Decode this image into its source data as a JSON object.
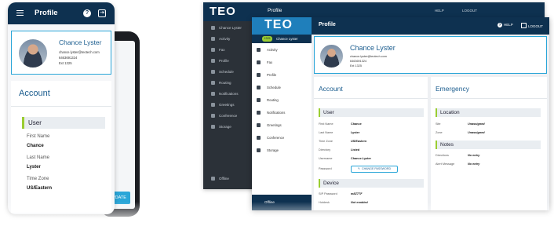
{
  "phone": {
    "title": "Profile",
    "help_glyph": "?",
    "logout_glyph": "⇥",
    "profile": {
      "name": "Chance Lyster",
      "email": "chance.lyster@teotech.com",
      "phone": "6463691324",
      "ext": "Ext 1325"
    },
    "account_heading": "Account",
    "user_section": "User",
    "fields": [
      {
        "label": "First Name",
        "value": "Chance"
      },
      {
        "label": "Last Name",
        "value": "Lyster"
      },
      {
        "label": "Time Zone",
        "value": "US/Eastern"
      }
    ],
    "back_update_button": "UPDATE"
  },
  "desktop_back": {
    "logo": "TEO",
    "title": "Profile",
    "user": "Chance Lyster",
    "help": "HELP",
    "logout": "LOGOUT",
    "sidebar": [
      "Activity",
      "Fax",
      "Profile",
      "Schedule",
      "Routing",
      "Notifications",
      "Greetings",
      "Conference",
      "Storage"
    ],
    "offline": "Offline"
  },
  "desktop": {
    "logo": "TEO",
    "title": "Profile",
    "help": "HELP",
    "logout": "LOGOUT",
    "user_badge": "1325",
    "user_name": "Chance Lyster",
    "sidebar": [
      {
        "label": "Activity",
        "icon": "activity-icon"
      },
      {
        "label": "Fax",
        "icon": "fax-icon"
      },
      {
        "label": "Profile",
        "icon": "profile-icon"
      },
      {
        "label": "Schedule",
        "icon": "schedule-icon"
      },
      {
        "label": "Routing",
        "icon": "routing-icon"
      },
      {
        "label": "Notifications",
        "icon": "bell-icon"
      },
      {
        "label": "Greetings",
        "icon": "greetings-icon"
      },
      {
        "label": "Conference",
        "icon": "conference-icon"
      },
      {
        "label": "Storage",
        "icon": "storage-icon"
      }
    ],
    "offline": "Offline",
    "profile": {
      "name": "Chance Lyster",
      "email": "chance.lyster@teotech.com",
      "phone": "6463691324",
      "ext": "Ext 1325"
    },
    "account": {
      "heading": "Account",
      "user_section": "User",
      "rows": [
        {
          "label": "First Name",
          "value": "Chance"
        },
        {
          "label": "Last Name",
          "value": "Lyster"
        },
        {
          "label": "Time Zone",
          "value": "US/Eastern"
        },
        {
          "label": "Directory",
          "value": "Listed"
        },
        {
          "label": "Username",
          "value": "Chance.Lyster"
        }
      ],
      "password_label": "Password",
      "change_password": "CHANGE PASSWORD",
      "device_section": "Device",
      "device_rows": [
        {
          "label": "SIP Password",
          "value": "m8Z7TF"
        },
        {
          "label": "Hotdesk",
          "value": "Not enabled"
        }
      ]
    },
    "emergency": {
      "heading": "Emergency",
      "location_section": "Location",
      "location_rows": [
        {
          "label": "Site",
          "value": "Unassigned"
        },
        {
          "label": "Zone",
          "value": "Unassigned"
        }
      ],
      "notes_section": "Notes",
      "notes_rows": [
        {
          "label": "Directions",
          "value": "No entry"
        },
        {
          "label": "Alert Message",
          "value": "No entry"
        }
      ]
    }
  },
  "colors": {
    "header_navy": "#0e3150",
    "accent_blue": "#2aa6d8",
    "accent_green": "#9acd32",
    "logo_blue": "#1f7fbb"
  }
}
